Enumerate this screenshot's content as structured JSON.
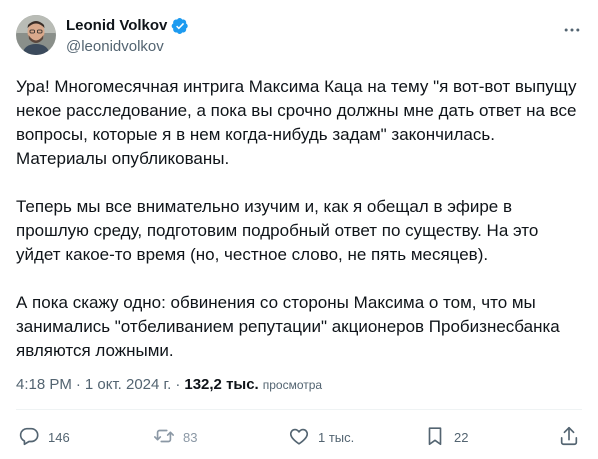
{
  "author": {
    "display_name": "Leonid Volkov",
    "handle": "@leonidvolkov",
    "verified": true
  },
  "tweet": {
    "paragraphs": [
      "Ура! Многомесячная интрига Максима Каца на тему \"я вот-вот выпущу некое расследование, а пока вы срочно должны мне дать ответ на все вопросы, которые я в нем когда-нибудь задам\" закончилась. Материалы опубликованы.",
      "Теперь мы все внимательно изучим и, как я обещал в эфире в прошлую среду, подготовим подробный ответ по существу. На это уйдет какое-то время (но, честное слово, не пять месяцев).",
      "А пока скажу одно: обвинения со стороны Максима о том, что мы занимались \"отбеливанием репутации\" акционеров Пробизнесбанка являются ложными."
    ],
    "time": "4:18 PM",
    "separator": "·",
    "date": "1 окт. 2024 г.",
    "views_count": "132,2 тыс.",
    "views_label": "просмотра"
  },
  "actions": {
    "reply_count": "146",
    "retweet_count": "83",
    "like_count": "1 тыс.",
    "bookmark_count": "22"
  },
  "colors": {
    "text_primary": "#0f1419",
    "text_secondary": "#536471",
    "verified_blue": "#1d9bf0",
    "divider": "#eff3f4"
  },
  "icons": [
    "avatar",
    "verified-badge-icon",
    "more-icon",
    "reply-icon",
    "retweet-icon",
    "like-icon",
    "bookmark-icon",
    "share-icon"
  ]
}
